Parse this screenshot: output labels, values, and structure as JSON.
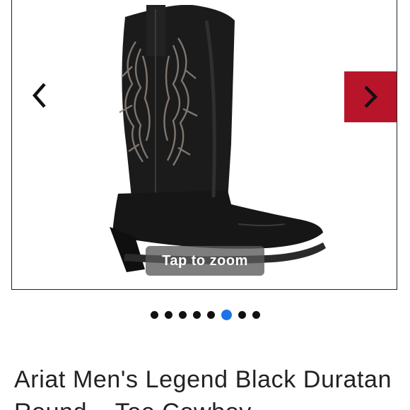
{
  "gallery": {
    "image_alt": "Ariat Men's Legend Black boot",
    "zoom_label": "Tap to zoom",
    "accent_color": "#b8152b",
    "dots": {
      "count": 8,
      "active_index": 5,
      "active_color": "#1a73e8"
    }
  },
  "product": {
    "title": "Ariat Men's Legend Black Duratan Round... Toe Cowboy"
  }
}
